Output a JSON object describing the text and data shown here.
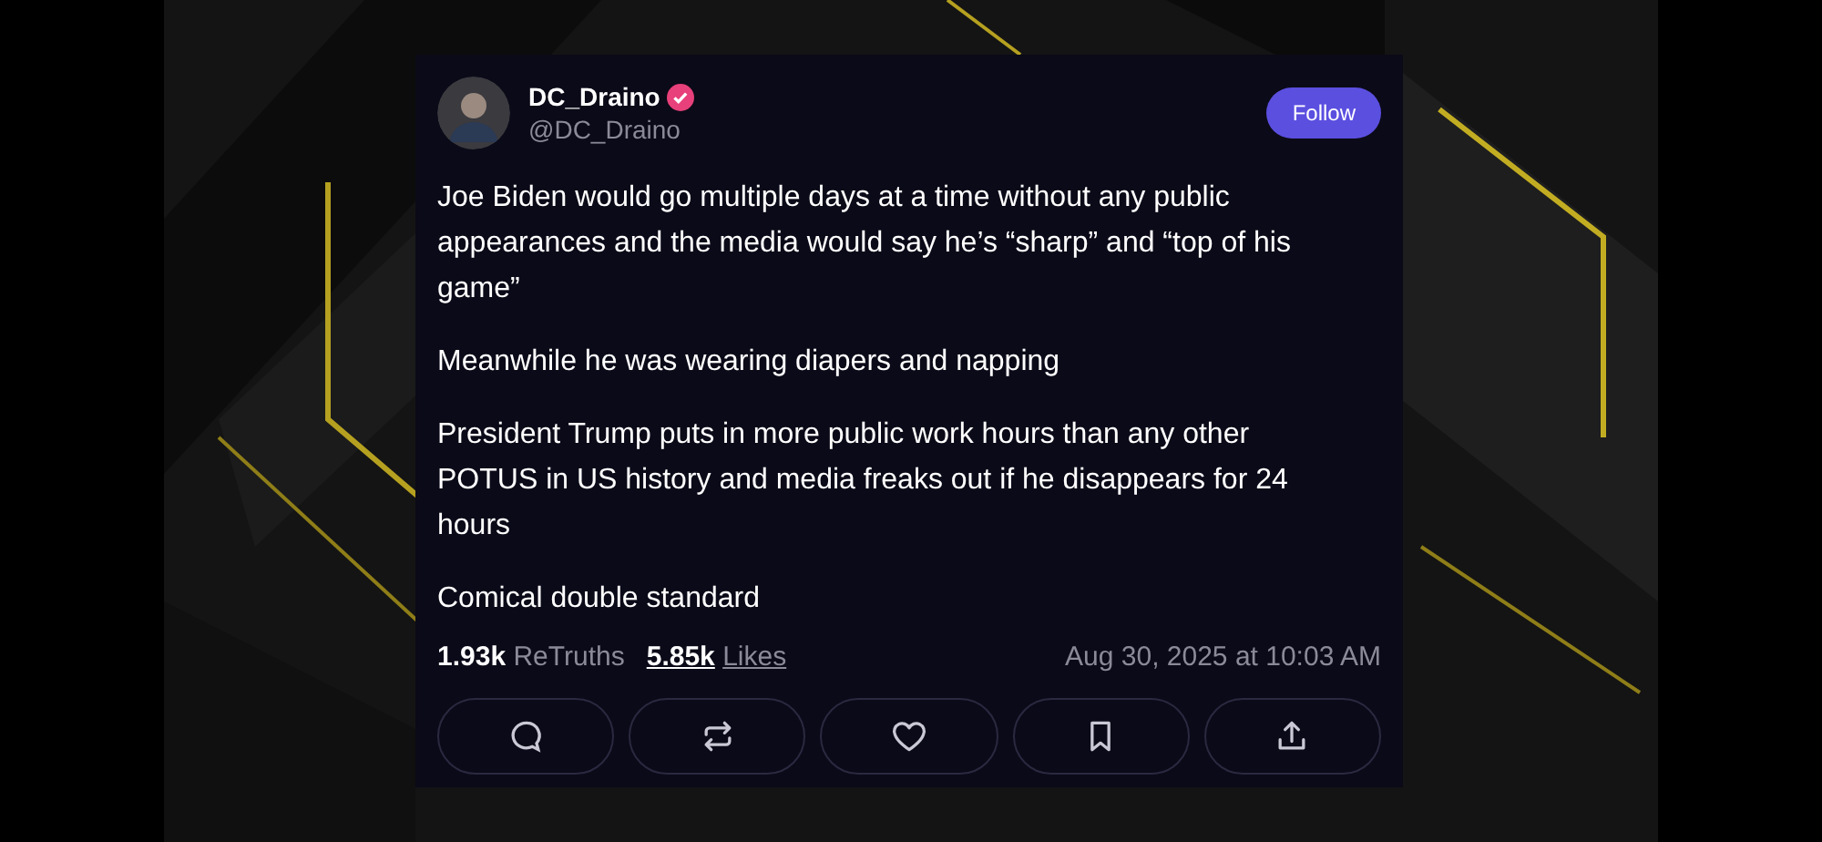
{
  "post": {
    "author": {
      "name": "DC_Draino",
      "handle": "@DC_Draino",
      "verified": true
    },
    "follow_button": "Follow",
    "paragraphs": [
      "Joe Biden would go multiple days at a time without any public appearances and the media would say he’s “sharp” and “top of his game”",
      "Meanwhile he was wearing diapers and napping",
      "President Trump puts in more public work hours than any other POTUS in US history and media freaks out if he disappears for 24 hours",
      "Comical double standard"
    ],
    "stats": [
      {
        "count": "1.93k",
        "label": "ReTruths",
        "linked": false
      },
      {
        "count": "5.85k",
        "label": "Likes",
        "linked": true
      }
    ],
    "timestamp": "Aug 30, 2025 at 10:03 AM",
    "actions": [
      {
        "kind": "reply"
      },
      {
        "kind": "retruth"
      },
      {
        "kind": "like"
      },
      {
        "kind": "bookmark"
      },
      {
        "kind": "share"
      }
    ]
  }
}
